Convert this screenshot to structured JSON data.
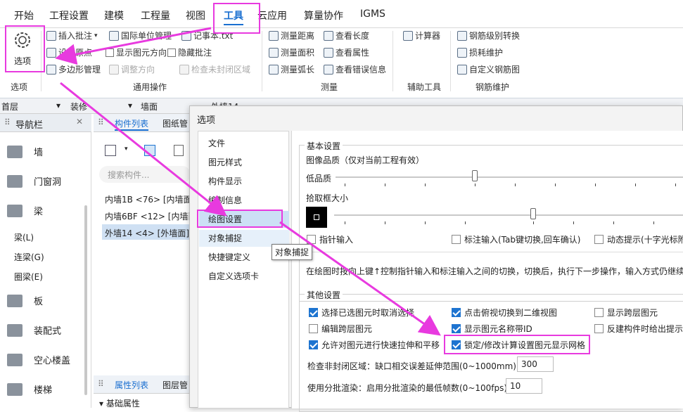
{
  "menubar": {
    "tabs": [
      "开始",
      "工程设置",
      "建模",
      "工程量",
      "视图",
      "工具",
      "云应用",
      "算量协作",
      "IGMS"
    ],
    "active_index": 5
  },
  "ribbon": {
    "options_label": "选项",
    "options_group": "选项",
    "general": {
      "insert_note": "插入批注",
      "set_origin": "设置原点",
      "polygon_manage": "多边形管理",
      "intl_unit": "国际单位管理",
      "show_direction": "显示图元方向",
      "adjust_direction": "调整方向",
      "notepad": "记事本.txt",
      "hide_note": "隐藏批注",
      "check_unclosed": "检查未封闭区域",
      "group": "通用操作"
    },
    "measure": {
      "dist": "测量距离",
      "area": "测量面积",
      "arc": "测量弧长",
      "len": "查看长度",
      "attr": "查看属性",
      "err": "查看错误信息",
      "group": "测量"
    },
    "aux": {
      "calc": "计算器",
      "group": "辅助工具"
    },
    "rebar": {
      "convert": "钢筋级别转换",
      "loss": "损耗维护",
      "custom": "自定义钢筋图",
      "group": "钢筋维护"
    }
  },
  "barrow": {
    "floor": "首层",
    "decor": "装修",
    "wall": "墙面",
    "wallx": "外墙14"
  },
  "leftnav": {
    "title": "导航栏",
    "items": [
      "墙",
      "门窗洞",
      "梁"
    ],
    "subitems": [
      "梁(L)",
      "连梁(G)",
      "圈梁(E)"
    ],
    "items2": [
      "板",
      "装配式",
      "空心楼盖",
      "楼梯"
    ]
  },
  "mid": {
    "tab1": "构件列表",
    "tab2": "图纸管",
    "search_placeholder": "搜索构件...",
    "rows": [
      "内墙1B <76> [内墙面",
      "内墙6BF <12> [内墙面",
      "外墙14 <4> [外墙面]"
    ],
    "tab3": "属性列表",
    "tab4": "图层管",
    "prop_row": "基础属性"
  },
  "dialog": {
    "title": "选项",
    "menu": [
      "文件",
      "图元样式",
      "构件显示",
      "编制信息",
      "绘图设置",
      "对象捕捉",
      "快捷键定义",
      "自定义选项卡"
    ],
    "selected_index": 4,
    "tooltip": "对象捕捉",
    "basic": {
      "title": "基本设置",
      "quality_label": "图像品质（仅对当前工程有效）",
      "low_quality": "低品质",
      "pick_size": "拾取框大小",
      "pointer_input": "指针输入",
      "dim_input": "标注输入(Tab键切换,回车确认)",
      "dynamic_tip": "动态提示(十字光标附",
      "desc": "在绘图时按向上键↑控制指针输入和标注输入之间的切换，切换后，执行下一步操作，输入方式仍继续"
    },
    "other": {
      "title": "其他设置",
      "items": [
        {
          "label": "选择已选图元时取消选择",
          "checked": true
        },
        {
          "label": "点击俯视切换到二维视图",
          "checked": true
        },
        {
          "label": "显示跨层图元",
          "checked": false
        },
        {
          "label": "编辑跨层图元",
          "checked": false
        },
        {
          "label": "显示图元名称带ID",
          "checked": true
        },
        {
          "label": "反建构件时给出提示",
          "checked": false
        },
        {
          "label": "允许对图元进行快速拉伸和平移",
          "checked": true
        },
        {
          "label": "锁定/修改计算设置图元显示网格",
          "checked": true
        }
      ],
      "check_label": "检查非封闭区域：缺口相交误差延伸范围(0~1000mm):",
      "check_value": "300",
      "batch_label": "使用分批渲染：启用分批渲染的最低帧数(0~100fps):",
      "batch_value": "10"
    }
  },
  "colors": {
    "highlight": "#e83adf",
    "accent": "#1e74d0",
    "active_tab": "#1a6fd0"
  }
}
